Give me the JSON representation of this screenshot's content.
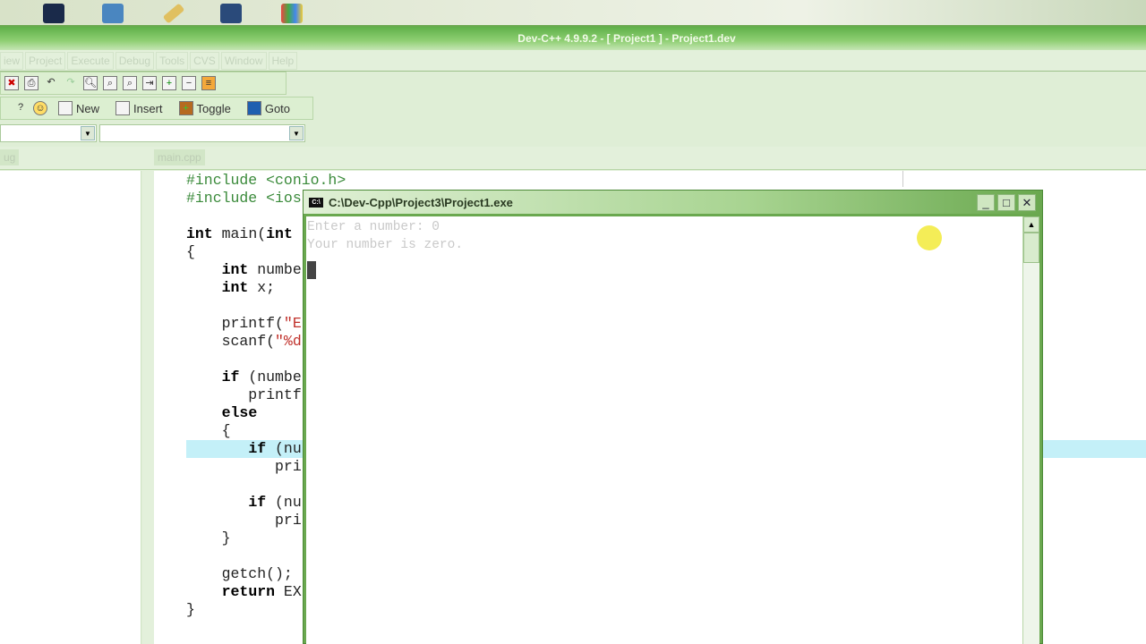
{
  "window": {
    "title": "Dev-C++ 4.9.9.2  - [ Project1 ] - Project1.dev"
  },
  "menu": [
    "iew",
    "Project",
    "Execute",
    "Debug",
    "Tools",
    "CVS",
    "Window",
    "Help"
  ],
  "toolbar2": {
    "new": "New",
    "insert": "Insert",
    "toggle": "Toggle",
    "goto": "Goto"
  },
  "tabs": {
    "left": "ug",
    "file": "main.cpp"
  },
  "code": [
    [
      {
        "t": "#include <conio.h>",
        "k": "pp"
      }
    ],
    [
      {
        "t": "#include <ios",
        "k": "pp"
      }
    ],
    [],
    [
      {
        "t": "int",
        "k": "kw"
      },
      {
        "t": " main("
      },
      {
        "t": "int",
        "k": "kw"
      }
    ],
    [
      {
        "t": "{"
      }
    ],
    [
      {
        "t": "    "
      },
      {
        "t": "int",
        "k": "kw"
      },
      {
        "t": " numbe"
      }
    ],
    [
      {
        "t": "    "
      },
      {
        "t": "int",
        "k": "kw"
      },
      {
        "t": " x;"
      }
    ],
    [],
    [
      {
        "t": "    printf("
      },
      {
        "t": "\"E",
        "k": "st"
      }
    ],
    [
      {
        "t": "    scanf("
      },
      {
        "t": "\"%d",
        "k": "st"
      }
    ],
    [],
    [
      {
        "t": "    "
      },
      {
        "t": "if",
        "k": "kw"
      },
      {
        "t": " (numbe"
      }
    ],
    [
      {
        "t": "       printf"
      }
    ],
    [
      {
        "t": "    "
      },
      {
        "t": "else",
        "k": "kw"
      }
    ],
    [
      {
        "t": "    {"
      }
    ],
    [
      {
        "t": "       "
      },
      {
        "t": "if",
        "k": "kw"
      },
      {
        "t": " (nu"
      }
    ],
    [
      {
        "t": "          pri"
      }
    ],
    [],
    [
      {
        "t": "       "
      },
      {
        "t": "if",
        "k": "kw"
      },
      {
        "t": " (nu"
      }
    ],
    [
      {
        "t": "          pri"
      }
    ],
    [
      {
        "t": "    }"
      }
    ],
    [],
    [
      {
        "t": "    getch();"
      }
    ],
    [
      {
        "t": "    "
      },
      {
        "t": "return",
        "k": "kw"
      },
      {
        "t": " EX"
      }
    ],
    [
      {
        "t": "}"
      }
    ]
  ],
  "highlight_line": 15,
  "console": {
    "title": "C:\\Dev-Cpp\\Project3\\Project1.exe",
    "lines": [
      "Enter a number: 0",
      "Your number is zero."
    ]
  }
}
